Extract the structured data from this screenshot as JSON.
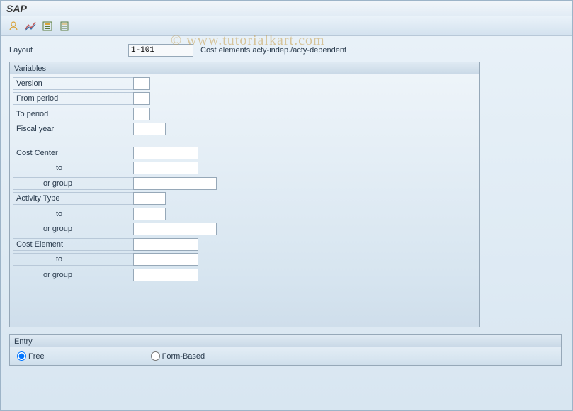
{
  "title": "SAP",
  "watermark": "© www.tutorialkart.com",
  "toolbar": {
    "icons": [
      "user-icon",
      "chart-icon",
      "form-icon",
      "notepad-icon"
    ]
  },
  "layout": {
    "label": "Layout",
    "value": "1-101",
    "description": "Cost elements acty-indep./acty-dependent"
  },
  "variables": {
    "header": "Variables",
    "rows": {
      "version_label": "Version",
      "from_period_label": "From period",
      "to_period_label": "To period",
      "fiscal_year_label": "Fiscal year",
      "cost_center_label": "Cost Center",
      "to_label": "to",
      "or_group_label": "or group",
      "activity_type_label": "Activity Type",
      "cost_element_label": "Cost Element"
    }
  },
  "entry": {
    "header": "Entry",
    "free_label": "Free",
    "form_based_label": "Form-Based"
  }
}
